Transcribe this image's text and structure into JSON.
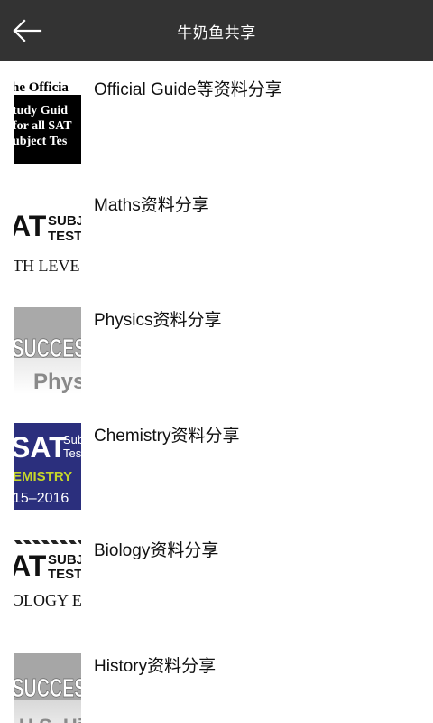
{
  "header": {
    "title": "牛奶鱼共享",
    "back_icon": "arrow-left-icon",
    "background": "#333333"
  },
  "items": [
    {
      "label": "Official Guide等资料分享",
      "cover_lines": [
        "he Officia",
        "tudy Guid",
        "for all SAT",
        "ubject Tes"
      ]
    },
    {
      "label": "Maths资料分享",
      "cover_lines": [
        "AT",
        "SUBJ",
        "TEST",
        "TH LEVE"
      ]
    },
    {
      "label": "Physics资料分享",
      "cover_lines": [
        "SUCCES",
        "Physi"
      ]
    },
    {
      "label": "Chemistry资料分享",
      "cover_lines": [
        "SAT",
        "Sub",
        "Test",
        "EMISTRY",
        "15–2016"
      ]
    },
    {
      "label": "Biology资料分享",
      "cover_lines": [
        "AT",
        "SUBJ",
        "TEST",
        "OLOGY E"
      ]
    },
    {
      "label": "History资料分享",
      "cover_lines": [
        "SUCCES",
        "U.S. Hi"
      ]
    }
  ]
}
